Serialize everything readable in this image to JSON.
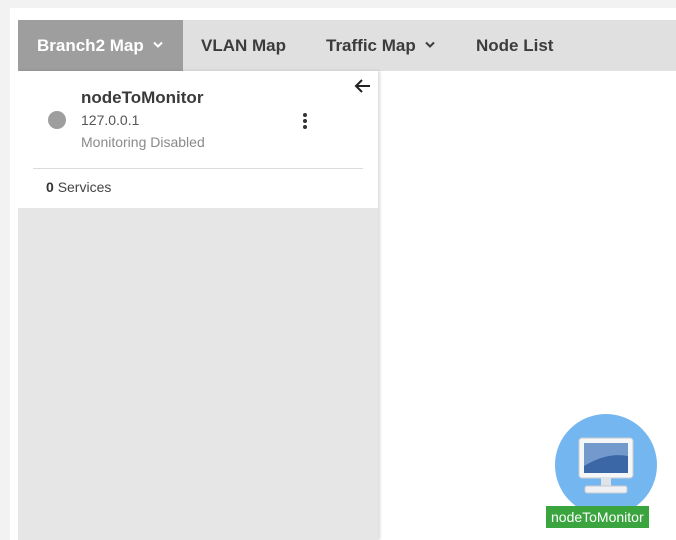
{
  "tabs": [
    {
      "label": "Branch2 Map",
      "dropdown": true,
      "active": true
    },
    {
      "label": "VLAN Map",
      "dropdown": false,
      "active": false
    },
    {
      "label": "Traffic Map",
      "dropdown": true,
      "active": false
    },
    {
      "label": "Node List",
      "dropdown": false,
      "active": false
    }
  ],
  "sidebar": {
    "node": {
      "name": "nodeToMonitor",
      "ip": "127.0.0.1",
      "status": "Monitoring Disabled",
      "status_color": "#9e9e9e"
    },
    "services_count": "0",
    "services_label": "Services",
    "back_icon": "arrow-left-icon",
    "menu_icon": "kebab-menu-icon"
  },
  "map": {
    "node_label": "nodeToMonitor",
    "node_icon": "computer-monitor-icon",
    "node_color": "#74b6ef",
    "label_color": "#3aa53f"
  }
}
